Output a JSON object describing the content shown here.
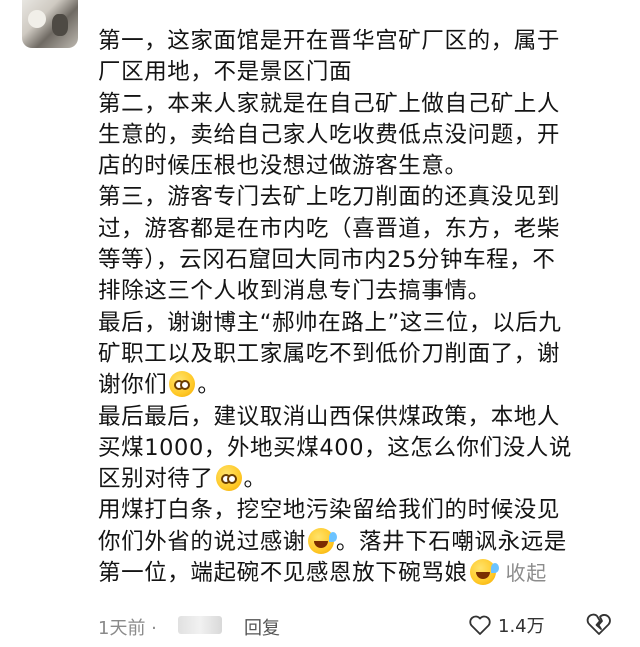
{
  "comment": {
    "p1": "第一，这家面馆是开在晋华宫矿厂区的，属于\n厂区用地，不是景区门面",
    "p2": "第二，本来人家就是在自己矿上做自己矿上人\n生意的，卖给自己家人吃收费低点没问题，开\n店的时候压根也没想过做游客生意。",
    "p3": "第三，游客专门去矿上吃刀削面的还真没见到\n过，游客都是在市内吃（喜晋道，东方，老柴\n等等），云冈石窟回大同市内25分钟车程，不\n排除这三个人收到消息专门去搞事情。",
    "p4": "最后，谢谢博主“郝帅在路上”这三位，以后九\n矿职工以及职工家属吃不到低价刀削面了，谢\n谢你们",
    "p4_end": "。",
    "p5": "最后最后，建议取消山西保供煤政策，本地人\n买煤1000，外地买煤400，这怎么你们没人说\n区别对待了",
    "p5_end": "。",
    "p6a": "用煤打白条，挖空地污染留给我们的时候没见\n你们外省的说过感谢",
    "p6b": "。落井下石嘲讽永远是\n第一位，端起碗不见感恩放下碗骂娘",
    "collapse": "收起"
  },
  "footer": {
    "time": "1天前 ·",
    "reply": "回复",
    "likes": "1.4万"
  },
  "colors": {
    "text": "#141414",
    "meta": "#8a8a8a",
    "emoji": "#ffc928"
  },
  "icons": [
    "heart-icon",
    "dislike-icon",
    "blush-emoji",
    "laugh-cry-emoji"
  ]
}
